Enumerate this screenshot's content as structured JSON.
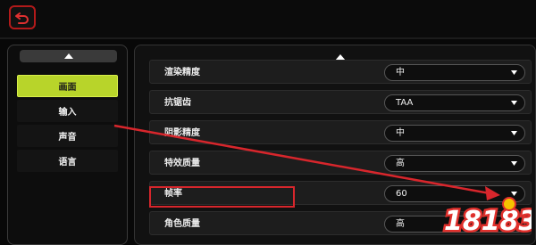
{
  "colors": {
    "accent": "#b8d42a",
    "annotation": "#d8262c",
    "background": "#080808"
  },
  "topbar": {
    "back_icon": "back-arrow-icon"
  },
  "menu": {
    "scroll_icon": "chevron-up-icon",
    "items": [
      {
        "label": "画面",
        "active": true
      },
      {
        "label": "输入",
        "active": false
      },
      {
        "label": "声音",
        "active": false
      },
      {
        "label": "语言",
        "active": false
      }
    ]
  },
  "settings": {
    "scroll_icon": "chevron-up-icon",
    "rows": [
      {
        "label": "渲染精度",
        "value": "中"
      },
      {
        "label": "抗锯齿",
        "value": "TAA"
      },
      {
        "label": "阴影精度",
        "value": "中"
      },
      {
        "label": "特效质量",
        "value": "高"
      },
      {
        "label": "帧率",
        "value": "60"
      },
      {
        "label": "角色质量",
        "value": "高"
      }
    ]
  },
  "watermark": {
    "text": "18183"
  }
}
